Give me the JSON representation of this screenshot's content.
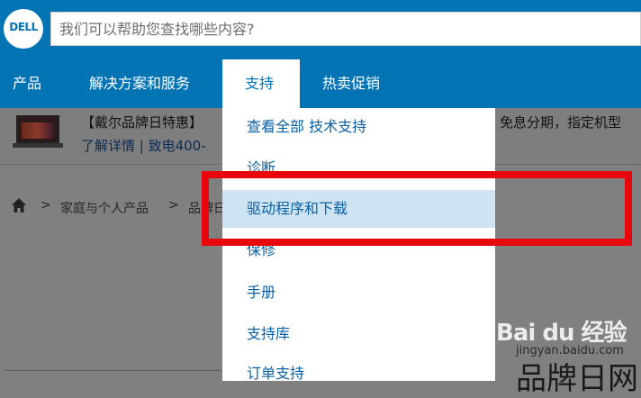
{
  "header": {
    "logo_text": "DELL",
    "search_placeholder": "我们可以帮助您查找哪些内容?"
  },
  "nav": {
    "items": [
      "产品",
      "解决方案和服务",
      "支持",
      "热卖促销"
    ],
    "active": "支持"
  },
  "promo": {
    "text": "【戴尔品牌日特惠】",
    "links": "了解详情 | 致电400-",
    "right_text": "免息分期，指定机型"
  },
  "breadcrumb": {
    "items": [
      "家庭与个人产品",
      "品牌日"
    ]
  },
  "page": {
    "big_title": "品牌日网"
  },
  "dropdown": {
    "items": [
      {
        "label": "查看全部 技术支持"
      },
      {
        "label": "诊断"
      },
      {
        "label": "驱动程序和下载"
      },
      {
        "label": "保修"
      },
      {
        "label": "手册"
      },
      {
        "label": "支持库"
      },
      {
        "label": "订单支持"
      }
    ],
    "highlighted": "驱动程序和下载"
  },
  "watermark": {
    "logo": "Bai du 经验",
    "url": "jingyan.baidu.com"
  },
  "colors": {
    "brand_blue": "#0273b3",
    "highlight": "#cfe4f3",
    "annotation_red": "#e8070d"
  }
}
